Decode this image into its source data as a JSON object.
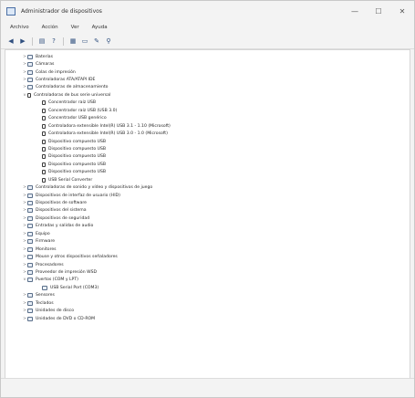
{
  "window": {
    "title": "Administrador de dispositivos"
  },
  "window_controls": {
    "minimize": "—",
    "maximize": "☐",
    "close": "✕"
  },
  "menubar": {
    "items": [
      "Archivo",
      "Acción",
      "Ver",
      "Ayuda"
    ]
  },
  "toolbar": {
    "back": "◀",
    "forward": "▶",
    "b1": "▤",
    "b2": "?",
    "b3": "▦",
    "b4": "▭",
    "b5": "✎",
    "b6": "⚲"
  },
  "tree": {
    "root": [
      {
        "exp": ">",
        "label": "Baterías"
      },
      {
        "exp": ">",
        "label": "Cámaras"
      },
      {
        "exp": ">",
        "label": "Colas de impresión"
      },
      {
        "exp": ">",
        "label": "Controladoras ATA/ATAPI IDE"
      },
      {
        "exp": ">",
        "label": "Controladoras de almacenamiento"
      },
      {
        "exp": "v",
        "label": "Controladoras de bus serie universal"
      }
    ],
    "usb_children": [
      "Concentrador raíz USB",
      "Concentrador raíz USB (USB 3.0)",
      "Concentrador USB genérico",
      "Controladora extensible Intel(R) USB 3.1 - 1.10 (Microsoft)",
      "Controladora extensible Intel(R) USB 3.0 - 1.0 (Microsoft)",
      "Dispositivo compuesto USB",
      "Dispositivo compuesto USB",
      "Dispositivo compuesto USB",
      "Dispositivo compuesto USB",
      "Dispositivo compuesto USB",
      "USB Serial Converter"
    ],
    "root_rest": [
      {
        "exp": ">",
        "label": "Controladoras de sonido y vídeo y dispositivos de juego"
      },
      {
        "exp": ">",
        "label": "Dispositivos de interfaz de usuario (HID)"
      },
      {
        "exp": ">",
        "label": "Dispositivos de software"
      },
      {
        "exp": ">",
        "label": "Dispositivos del sistema"
      },
      {
        "exp": ">",
        "label": "Dispositivos de seguridad"
      },
      {
        "exp": ">",
        "label": "Entradas y salidas de audio"
      },
      {
        "exp": ">",
        "label": "Equipo"
      },
      {
        "exp": ">",
        "label": "Firmware"
      },
      {
        "exp": ">",
        "label": "Monitores"
      },
      {
        "exp": ">",
        "label": "Mouse y otros dispositivos señaladores"
      },
      {
        "exp": ">",
        "label": "Procesadores"
      },
      {
        "exp": ">",
        "label": "Proveedor de impresión WSD"
      },
      {
        "exp": "v",
        "label": "Puertos (COM y LPT)"
      }
    ],
    "ports_children": [
      "USB Serial Port (COM3)"
    ],
    "root_tail": [
      {
        "exp": ">",
        "label": "Sensores"
      },
      {
        "exp": ">",
        "label": "Teclados"
      },
      {
        "exp": ">",
        "label": "Unidades de disco"
      },
      {
        "exp": ">",
        "label": "Unidades de DVD o CD-ROM"
      }
    ]
  }
}
